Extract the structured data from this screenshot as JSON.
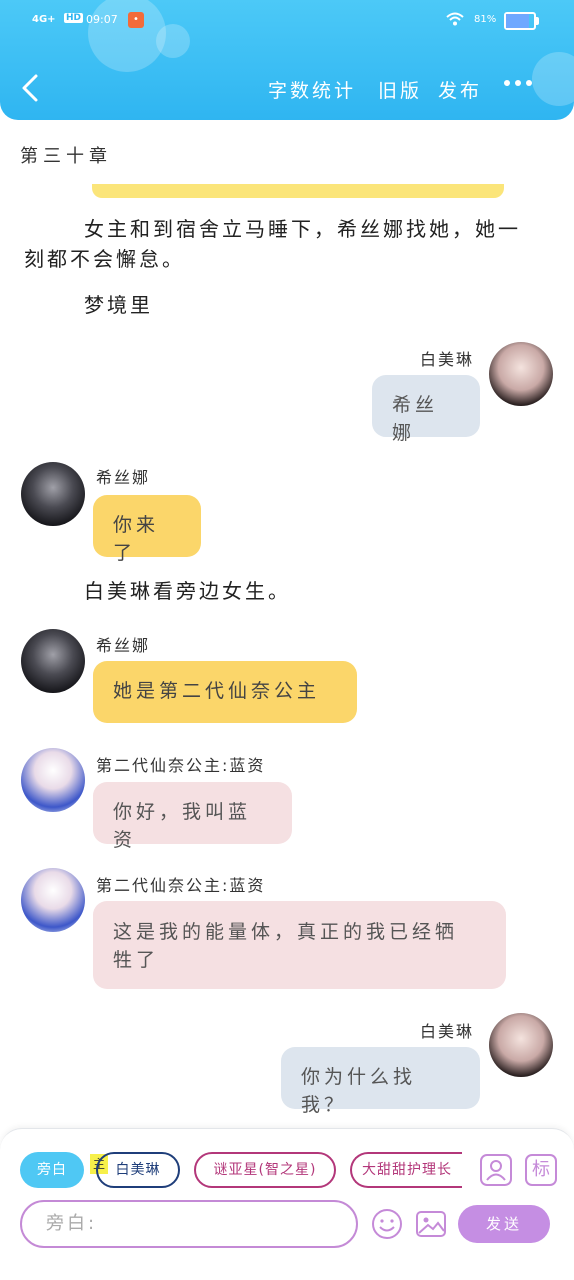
{
  "status_bar": {
    "network": "4G+",
    "hd": "HD",
    "time": "09:07",
    "battery_text": "81%",
    "battery_level": 0.81
  },
  "header": {
    "back_icon": "chevron-left-icon",
    "word_count": "字数统计",
    "old_version": "旧版",
    "publish": "发布",
    "more_icon": "more-dots-icon",
    "background_color": "#3dbff5"
  },
  "chapter_title": "第三十章",
  "paragraphs": {
    "p1_line1": "女主和到宿舍立马睡下，希丝娜找她，她一",
    "p1_line2": "刻都不会懈怠。",
    "p2": "梦境里",
    "p3": "白美琳看旁边女生。"
  },
  "messages": {
    "m1": {
      "name": "白美琳",
      "text": "希丝娜"
    },
    "m2": {
      "name": "希丝娜",
      "text": "你来了"
    },
    "m3": {
      "name": "希丝娜",
      "text": "她是第二代仙奈公主"
    },
    "m4": {
      "name": "第二代仙奈公主:蓝资",
      "text": "你好，我叫蓝资"
    },
    "m5": {
      "name": "第二代仙奈公主:蓝资",
      "text_line1": "这是我的能量体，真正的我已经牺",
      "text_line2": "牲了"
    },
    "m6": {
      "name": "白美琳",
      "text": "你为什么找我？"
    }
  },
  "composer": {
    "chips": {
      "narrator": "旁白",
      "main_tag": "主",
      "bai": "白美琳",
      "mi": "谜亚星(智之星)",
      "da": "大甜甜护理长"
    },
    "tag_icon_text": "标",
    "placeholder": "旁白:",
    "send": "发送",
    "accent_color": "#c58ee3"
  }
}
